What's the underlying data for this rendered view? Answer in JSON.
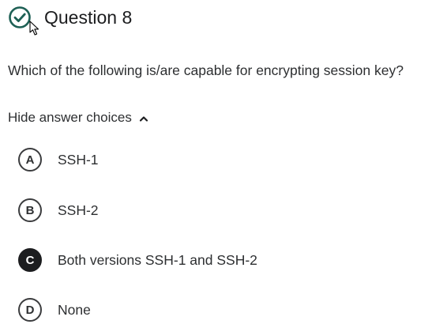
{
  "question": {
    "status_icon": "check-circle-icon",
    "status_color": "#1e6055",
    "title": "Question 8",
    "prompt": "Which of the following is/are capable for encrypting session key?"
  },
  "answer_toggle": {
    "label": "Hide answer choices",
    "icon": "chevron-up-icon"
  },
  "choices": [
    {
      "letter": "A",
      "text": "SSH-1",
      "selected": false
    },
    {
      "letter": "B",
      "text": "SSH-2",
      "selected": false
    },
    {
      "letter": "C",
      "text": "Both versions SSH-1 and SSH-2",
      "selected": true
    },
    {
      "letter": "D",
      "text": "None",
      "selected": false
    }
  ]
}
